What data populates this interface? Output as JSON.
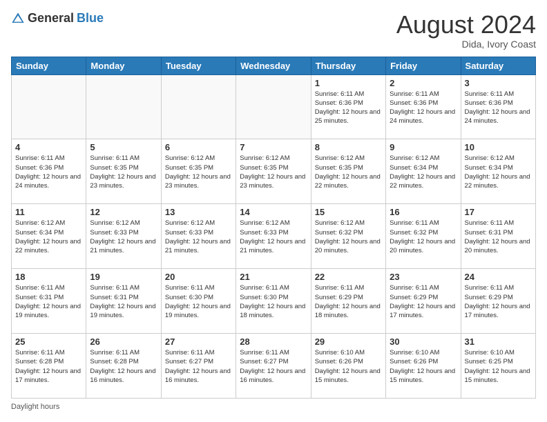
{
  "header": {
    "logo_general": "General",
    "logo_blue": "Blue",
    "month_title": "August 2024",
    "location": "Dida, Ivory Coast"
  },
  "days_of_week": [
    "Sunday",
    "Monday",
    "Tuesday",
    "Wednesday",
    "Thursday",
    "Friday",
    "Saturday"
  ],
  "footer": {
    "label": "Daylight hours"
  },
  "weeks": [
    [
      {
        "day": "",
        "info": ""
      },
      {
        "day": "",
        "info": ""
      },
      {
        "day": "",
        "info": ""
      },
      {
        "day": "",
        "info": ""
      },
      {
        "day": "1",
        "info": "Sunrise: 6:11 AM\nSunset: 6:36 PM\nDaylight: 12 hours\nand 25 minutes."
      },
      {
        "day": "2",
        "info": "Sunrise: 6:11 AM\nSunset: 6:36 PM\nDaylight: 12 hours\nand 24 minutes."
      },
      {
        "day": "3",
        "info": "Sunrise: 6:11 AM\nSunset: 6:36 PM\nDaylight: 12 hours\nand 24 minutes."
      }
    ],
    [
      {
        "day": "4",
        "info": "Sunrise: 6:11 AM\nSunset: 6:36 PM\nDaylight: 12 hours\nand 24 minutes."
      },
      {
        "day": "5",
        "info": "Sunrise: 6:11 AM\nSunset: 6:35 PM\nDaylight: 12 hours\nand 23 minutes."
      },
      {
        "day": "6",
        "info": "Sunrise: 6:12 AM\nSunset: 6:35 PM\nDaylight: 12 hours\nand 23 minutes."
      },
      {
        "day": "7",
        "info": "Sunrise: 6:12 AM\nSunset: 6:35 PM\nDaylight: 12 hours\nand 23 minutes."
      },
      {
        "day": "8",
        "info": "Sunrise: 6:12 AM\nSunset: 6:35 PM\nDaylight: 12 hours\nand 22 minutes."
      },
      {
        "day": "9",
        "info": "Sunrise: 6:12 AM\nSunset: 6:34 PM\nDaylight: 12 hours\nand 22 minutes."
      },
      {
        "day": "10",
        "info": "Sunrise: 6:12 AM\nSunset: 6:34 PM\nDaylight: 12 hours\nand 22 minutes."
      }
    ],
    [
      {
        "day": "11",
        "info": "Sunrise: 6:12 AM\nSunset: 6:34 PM\nDaylight: 12 hours\nand 22 minutes."
      },
      {
        "day": "12",
        "info": "Sunrise: 6:12 AM\nSunset: 6:33 PM\nDaylight: 12 hours\nand 21 minutes."
      },
      {
        "day": "13",
        "info": "Sunrise: 6:12 AM\nSunset: 6:33 PM\nDaylight: 12 hours\nand 21 minutes."
      },
      {
        "day": "14",
        "info": "Sunrise: 6:12 AM\nSunset: 6:33 PM\nDaylight: 12 hours\nand 21 minutes."
      },
      {
        "day": "15",
        "info": "Sunrise: 6:12 AM\nSunset: 6:32 PM\nDaylight: 12 hours\nand 20 minutes."
      },
      {
        "day": "16",
        "info": "Sunrise: 6:11 AM\nSunset: 6:32 PM\nDaylight: 12 hours\nand 20 minutes."
      },
      {
        "day": "17",
        "info": "Sunrise: 6:11 AM\nSunset: 6:31 PM\nDaylight: 12 hours\nand 20 minutes."
      }
    ],
    [
      {
        "day": "18",
        "info": "Sunrise: 6:11 AM\nSunset: 6:31 PM\nDaylight: 12 hours\nand 19 minutes."
      },
      {
        "day": "19",
        "info": "Sunrise: 6:11 AM\nSunset: 6:31 PM\nDaylight: 12 hours\nand 19 minutes."
      },
      {
        "day": "20",
        "info": "Sunrise: 6:11 AM\nSunset: 6:30 PM\nDaylight: 12 hours\nand 19 minutes."
      },
      {
        "day": "21",
        "info": "Sunrise: 6:11 AM\nSunset: 6:30 PM\nDaylight: 12 hours\nand 18 minutes."
      },
      {
        "day": "22",
        "info": "Sunrise: 6:11 AM\nSunset: 6:29 PM\nDaylight: 12 hours\nand 18 minutes."
      },
      {
        "day": "23",
        "info": "Sunrise: 6:11 AM\nSunset: 6:29 PM\nDaylight: 12 hours\nand 17 minutes."
      },
      {
        "day": "24",
        "info": "Sunrise: 6:11 AM\nSunset: 6:29 PM\nDaylight: 12 hours\nand 17 minutes."
      }
    ],
    [
      {
        "day": "25",
        "info": "Sunrise: 6:11 AM\nSunset: 6:28 PM\nDaylight: 12 hours\nand 17 minutes."
      },
      {
        "day": "26",
        "info": "Sunrise: 6:11 AM\nSunset: 6:28 PM\nDaylight: 12 hours\nand 16 minutes."
      },
      {
        "day": "27",
        "info": "Sunrise: 6:11 AM\nSunset: 6:27 PM\nDaylight: 12 hours\nand 16 minutes."
      },
      {
        "day": "28",
        "info": "Sunrise: 6:11 AM\nSunset: 6:27 PM\nDaylight: 12 hours\nand 16 minutes."
      },
      {
        "day": "29",
        "info": "Sunrise: 6:10 AM\nSunset: 6:26 PM\nDaylight: 12 hours\nand 15 minutes."
      },
      {
        "day": "30",
        "info": "Sunrise: 6:10 AM\nSunset: 6:26 PM\nDaylight: 12 hours\nand 15 minutes."
      },
      {
        "day": "31",
        "info": "Sunrise: 6:10 AM\nSunset: 6:25 PM\nDaylight: 12 hours\nand 15 minutes."
      }
    ]
  ]
}
